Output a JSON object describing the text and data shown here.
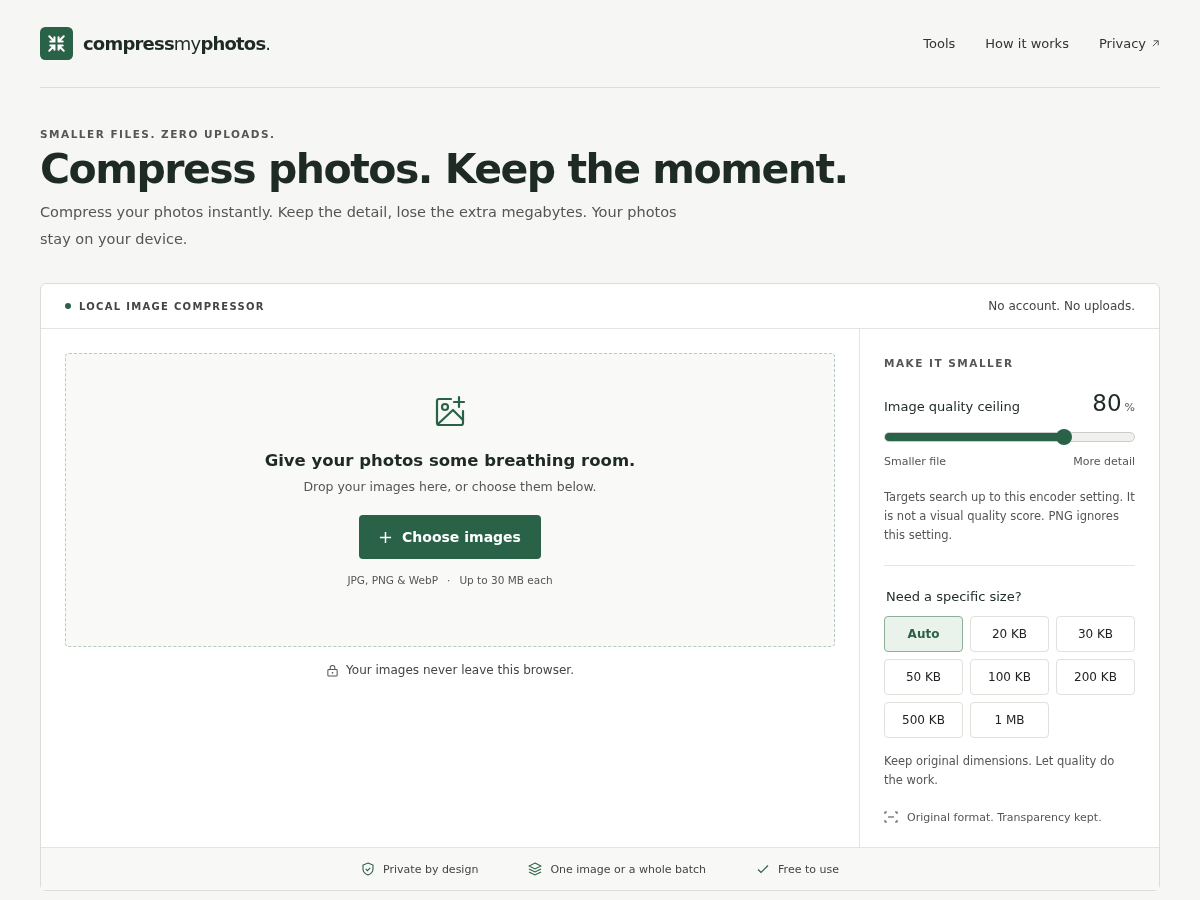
{
  "brand": "**compress**my**photos**.",
  "nav": [
    {
      "label": "Tools",
      "external": false
    },
    {
      "label": "How it works",
      "external": false
    },
    {
      "label": "Privacy",
      "external": true
    }
  ],
  "hero": {
    "eyebrow": "SMALLER FILES. ZERO UPLOADS.",
    "title": "Compress photos. Keep the moment.",
    "lead": "Compress your photos instantly. Keep the detail, lose the extra megabytes. Your photos stay on your device."
  },
  "card": {
    "label": "LOCAL IMAGE COMPRESSOR",
    "note": "No account. No uploads.",
    "drop": {
      "title": "Give your photos some breathing room.",
      "subtitle": "Drop your images here, or choose them below.",
      "button": "Choose images",
      "formats": "JPG, PNG & WebP",
      "separator": "·",
      "limit": "Up to 30 MB each"
    },
    "privacy_note": "Your images never leave this browser.",
    "settings": {
      "heading": "MAKE IT SMALLER",
      "quality_label": "Image quality ceiling",
      "quality_value": "80",
      "quality_unit": "%",
      "level": 0.72,
      "min_label": "Smaller file",
      "max_label": "More detail",
      "help": "Targets search up to this encoder setting. It is not a visual quality score. PNG ignores this setting.",
      "size_heading": "Need a specific size?",
      "sizes": [
        {
          "label": "Auto",
          "selected": true
        },
        {
          "label": "20 KB",
          "selected": false
        },
        {
          "label": "30 KB",
          "selected": false
        },
        {
          "label": "50 KB",
          "selected": false
        },
        {
          "label": "100 KB",
          "selected": false
        },
        {
          "label": "200 KB",
          "selected": false
        },
        {
          "label": "500 KB",
          "selected": false
        },
        {
          "label": "1 MB",
          "selected": false
        }
      ],
      "size_help": "Keep original dimensions. Let quality do the work.",
      "format_note": "Original format. Transparency kept."
    },
    "features": [
      {
        "kind": "shield",
        "label": "Private by design"
      },
      {
        "kind": "layers",
        "label": "One image or a whole batch"
      },
      {
        "kind": "check",
        "label": "Free to use"
      }
    ]
  }
}
